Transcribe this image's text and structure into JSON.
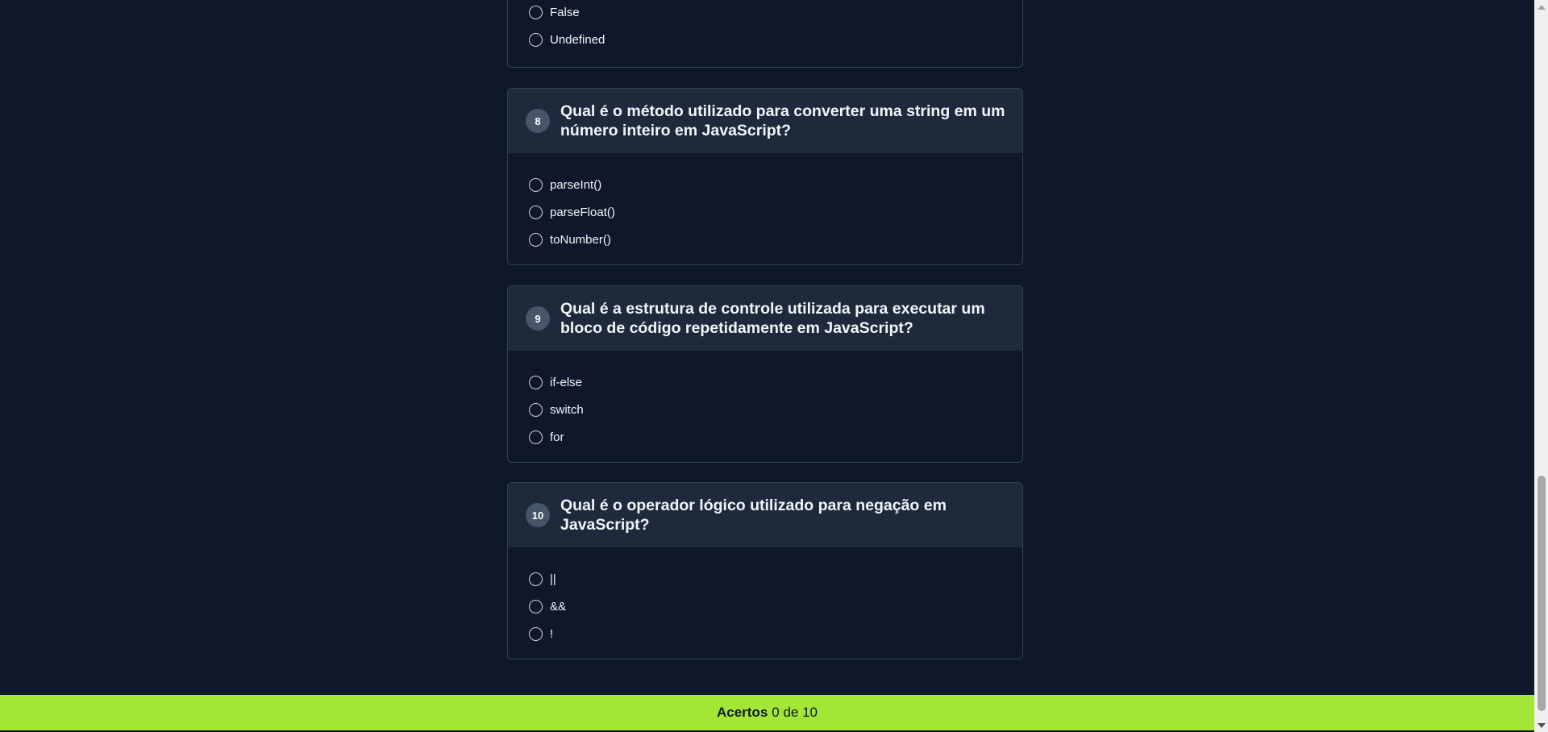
{
  "question7": {
    "options": [
      "False",
      "Undefined"
    ]
  },
  "questions": [
    {
      "number": "8",
      "text": "Qual é o método utilizado para converter uma string em um número inteiro em JavaScript?",
      "options": [
        "parseInt()",
        "parseFloat()",
        "toNumber()"
      ]
    },
    {
      "number": "9",
      "text": "Qual é a estrutura de controle utilizada para executar um bloco de código repetidamente em JavaScript?",
      "options": [
        "if-else",
        "switch",
        "for"
      ]
    },
    {
      "number": "10",
      "text": "Qual é o operador lógico utilizado para negação em JavaScript?",
      "options": [
        "||",
        "&&",
        "!"
      ]
    }
  ],
  "footer": {
    "label": "Acertos",
    "score": "0 de 10"
  },
  "colors": {
    "background": "#0f172a",
    "card_header": "#1e293b",
    "badge": "#475569",
    "footer_accent": "#a3e635"
  }
}
